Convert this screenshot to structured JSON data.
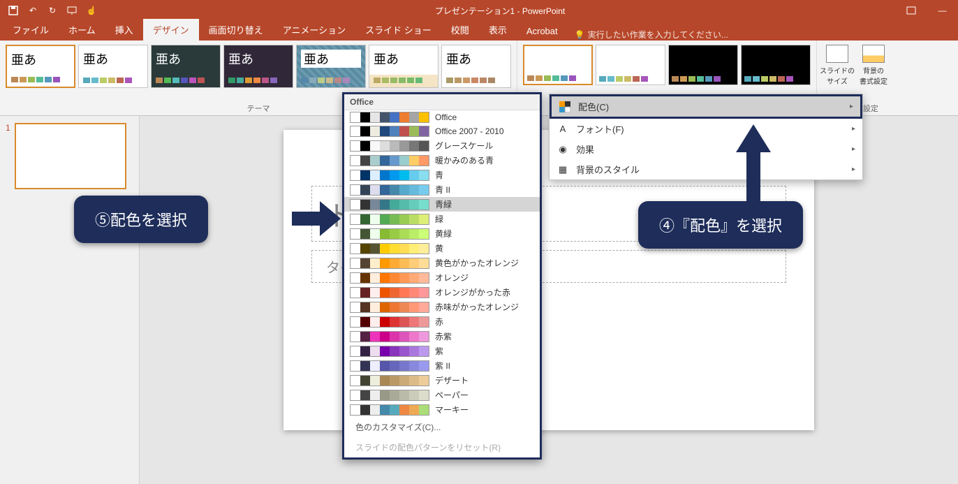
{
  "app": {
    "title": "プレゼンテーション1 - PowerPoint"
  },
  "tabs": {
    "file": "ファイル",
    "home": "ホーム",
    "insert": "挿入",
    "design": "デザイン",
    "transitions": "画面切り替え",
    "animations": "アニメーション",
    "slideshow": "スライド ショー",
    "review": "校閲",
    "view": "表示",
    "acrobat": "Acrobat",
    "tellme": "実行したい作業を入力してください..."
  },
  "ribbon": {
    "theme_text": "亜あ",
    "theme_group_label": "テーマ",
    "slide_size": "スライドの\nサイズ",
    "format_bg": "背景の\n書式設定",
    "user_group_label": "ユーザー設定"
  },
  "variant_menu": {
    "colors": "配色(C)",
    "fonts": "フォント(F)",
    "effects": "効果",
    "bg_styles": "背景のスタイル"
  },
  "colors_popup": {
    "header": "Office",
    "schemes": [
      {
        "name": "Office",
        "c": [
          "#fff",
          "#000",
          "#e7e6e6",
          "#44546a",
          "#4472c4",
          "#ed7d31",
          "#a5a5a5",
          "#ffc000"
        ]
      },
      {
        "name": "Office 2007 - 2010",
        "c": [
          "#fff",
          "#000",
          "#eeece1",
          "#1f497d",
          "#4f81bd",
          "#c0504d",
          "#9bbb59",
          "#8064a2"
        ]
      },
      {
        "name": "グレースケール",
        "c": [
          "#fff",
          "#000",
          "#f8f8f8",
          "#ddd",
          "#bbb",
          "#999",
          "#777",
          "#555"
        ]
      },
      {
        "name": "暖かみのある青",
        "c": [
          "#fff",
          "#444",
          "#acc",
          "#369",
          "#69c",
          "#9cc",
          "#fc6",
          "#f96"
        ]
      },
      {
        "name": "青",
        "c": [
          "#fff",
          "#036",
          "#def",
          "#07c",
          "#09e",
          "#0be",
          "#6ce",
          "#8de"
        ]
      },
      {
        "name": "青 II",
        "c": [
          "#fff",
          "#345",
          "#dde",
          "#369",
          "#48a",
          "#5ac",
          "#6bd",
          "#7ce"
        ]
      },
      {
        "name": "青緑",
        "c": [
          "#fff",
          "#333",
          "#789",
          "#378",
          "#4a9",
          "#5ba",
          "#6cb",
          "#7dc"
        ]
      },
      {
        "name": "緑",
        "c": [
          "#fff",
          "#363",
          "#efe",
          "#5a5",
          "#7b5",
          "#9c5",
          "#bd6",
          "#de7"
        ]
      },
      {
        "name": "黄緑",
        "c": [
          "#fff",
          "#453",
          "#efe",
          "#8b3",
          "#9c4",
          "#ad5",
          "#be6",
          "#cf7"
        ]
      },
      {
        "name": "黄",
        "c": [
          "#fff",
          "#540",
          "#553",
          "#fc0",
          "#fd3",
          "#fd5",
          "#fe7",
          "#fe9"
        ]
      },
      {
        "name": "黄色がかったオレンジ",
        "c": [
          "#fff",
          "#543",
          "#fec",
          "#f90",
          "#fa3",
          "#fb5",
          "#fc7",
          "#fd9"
        ]
      },
      {
        "name": "オレンジ",
        "c": [
          "#fff",
          "#630",
          "#fed",
          "#f70",
          "#f83",
          "#f95",
          "#fa7",
          "#fb9"
        ]
      },
      {
        "name": "オレンジがかった赤",
        "c": [
          "#fff",
          "#622",
          "#fee",
          "#e50",
          "#e63",
          "#f75",
          "#f87",
          "#f99"
        ]
      },
      {
        "name": "赤味がかったオレンジ",
        "c": [
          "#fff",
          "#532",
          "#fed",
          "#d60",
          "#e73",
          "#e85",
          "#f97",
          "#fa9"
        ]
      },
      {
        "name": "赤",
        "c": [
          "#fff",
          "#500",
          "#fee",
          "#c00",
          "#d33",
          "#d55",
          "#e77",
          "#e99"
        ]
      },
      {
        "name": "赤紫",
        "c": [
          "#fff",
          "#524",
          "#e3b",
          "#c08",
          "#d3a",
          "#d5b",
          "#e7c",
          "#e9d"
        ]
      },
      {
        "name": "紫",
        "c": [
          "#fff",
          "#324",
          "#ede",
          "#70a",
          "#83b",
          "#95c",
          "#a7d",
          "#b9e"
        ]
      },
      {
        "name": "紫 II",
        "c": [
          "#fff",
          "#335",
          "#eef",
          "#55a",
          "#66b",
          "#77c",
          "#88d",
          "#99e"
        ]
      },
      {
        "name": "デザート",
        "c": [
          "#fff",
          "#443",
          "#eed",
          "#a85",
          "#b96",
          "#ca7",
          "#db8",
          "#ec9"
        ]
      },
      {
        "name": "ペーパー",
        "c": [
          "#fff",
          "#444",
          "#eee",
          "#998",
          "#aa9",
          "#bba",
          "#ccb",
          "#ddc"
        ]
      },
      {
        "name": "マーキー",
        "c": [
          "#fff",
          "#333",
          "#eee",
          "#48a",
          "#5ab",
          "#e84",
          "#ea5",
          "#ad7"
        ]
      }
    ],
    "customize": "色のカスタマイズ(C)...",
    "reset": "スライドの配色パターンをリセット(R)"
  },
  "slide": {
    "number": "1",
    "title_placeholder": "トルを入力",
    "subtitle_placeholder": "タイトルを入力"
  },
  "callouts": {
    "step5": "⑤配色を選択",
    "step4": "④『配色』を選択"
  }
}
